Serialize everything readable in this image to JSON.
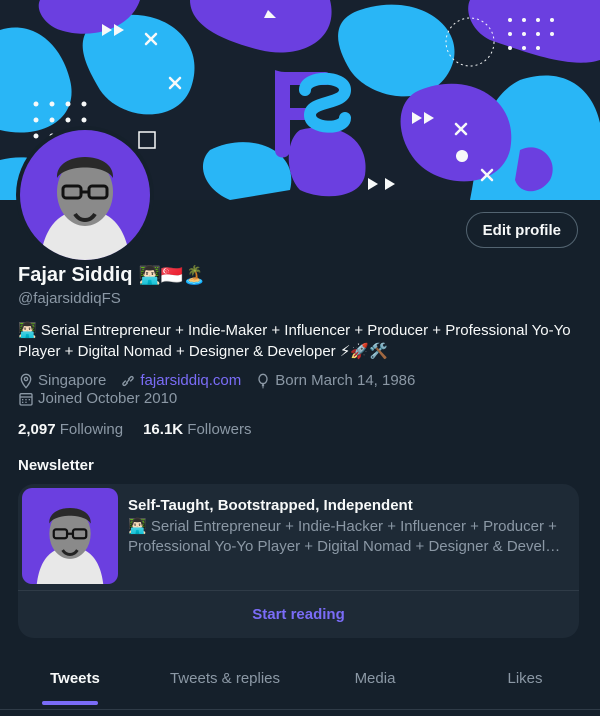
{
  "profile": {
    "display_name": "Fajar Siddiq",
    "name_emoji": "👨🏻‍💻🇸🇬🏝️",
    "handle": "@fajarsiddiqFS",
    "edit_label": "Edit profile",
    "bio_line1": "👨🏻‍💻 Serial Entrepreneur + Indie-Maker + Influencer + Producer + Professional Yo-Yo",
    "bio_line2": "Player + Digital Nomad + Designer & Developer ⚡🚀🛠️",
    "location": "Singapore",
    "website": "fajarsiddiq.com",
    "birthday": "Born March 14, 1986",
    "joined": "Joined October 2010",
    "following_count": "2,097",
    "following_label": "Following",
    "followers_count": "16.1K",
    "followers_label": "Followers"
  },
  "newsletter": {
    "heading": "Newsletter",
    "title": "Self-Taught, Bootstrapped, Independent",
    "desc_line1": "👨🏻‍💻 Serial Entrepreneur + Indie-Hacker + Influencer + Producer +",
    "desc_line2": "Professional Yo-Yo Player + Digital Nomad + Designer & Develop...",
    "cta": "Start reading"
  },
  "tabs": [
    {
      "label": "Tweets"
    },
    {
      "label": "Tweets & replies"
    },
    {
      "label": "Media"
    },
    {
      "label": "Likes"
    }
  ],
  "colors": {
    "background": "#15202b",
    "accent": "#7a6cf7",
    "banner_purple": "#6b3fe0",
    "banner_cyan": "#29b6f6"
  },
  "icons": [
    "location-icon",
    "link-icon",
    "balloon-icon",
    "calendar-icon"
  ]
}
